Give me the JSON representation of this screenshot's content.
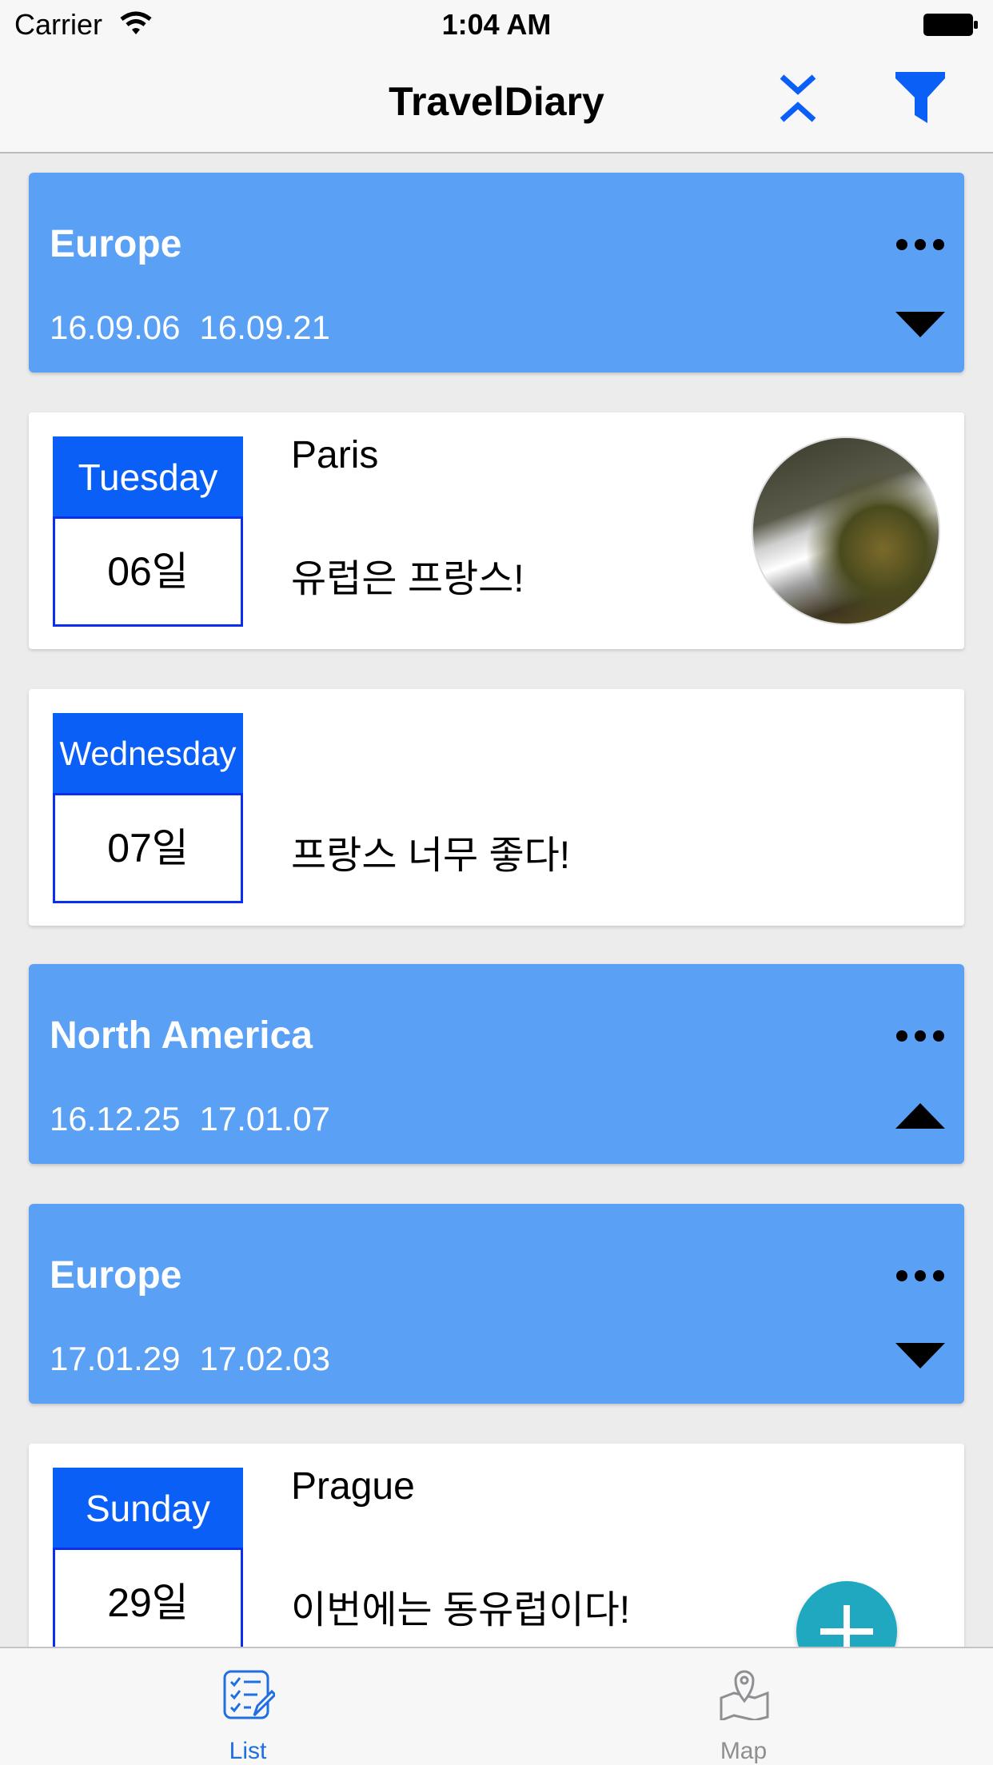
{
  "status_bar": {
    "carrier": "Carrier",
    "time": "1:04 AM"
  },
  "nav": {
    "title": "TravelDiary"
  },
  "colors": {
    "trip_header": "#5aa0f5",
    "weekday_bg": "#0a5ff7",
    "fab": "#1fa8c0",
    "tab_active": "#1f6fe0"
  },
  "trips": [
    {
      "title": "Europe",
      "start": "16.09.06",
      "end": "16.09.21",
      "arrow": "down"
    },
    {
      "title": "North America",
      "start": "16.12.25",
      "end": "17.01.07",
      "arrow": "up"
    },
    {
      "title": "Europe",
      "start": "17.01.29",
      "end": "17.02.03",
      "arrow": "down"
    }
  ],
  "days": [
    {
      "weekday": "Tuesday",
      "date": "06일",
      "place": "Paris",
      "note": "유럽은 프랑스!",
      "has_photo": true
    },
    {
      "weekday": "Wednesday",
      "date": "07일",
      "place": "",
      "note": "프랑스 너무 좋다!",
      "has_photo": false
    },
    {
      "weekday": "Sunday",
      "date": "29일",
      "place": "Prague",
      "note": "이번에는 동유럽이다!",
      "has_photo": false
    }
  ],
  "tabs": [
    {
      "label": "List",
      "icon": "checklist-icon",
      "active": true
    },
    {
      "label": "Map",
      "icon": "map-pin-icon",
      "active": false
    }
  ]
}
